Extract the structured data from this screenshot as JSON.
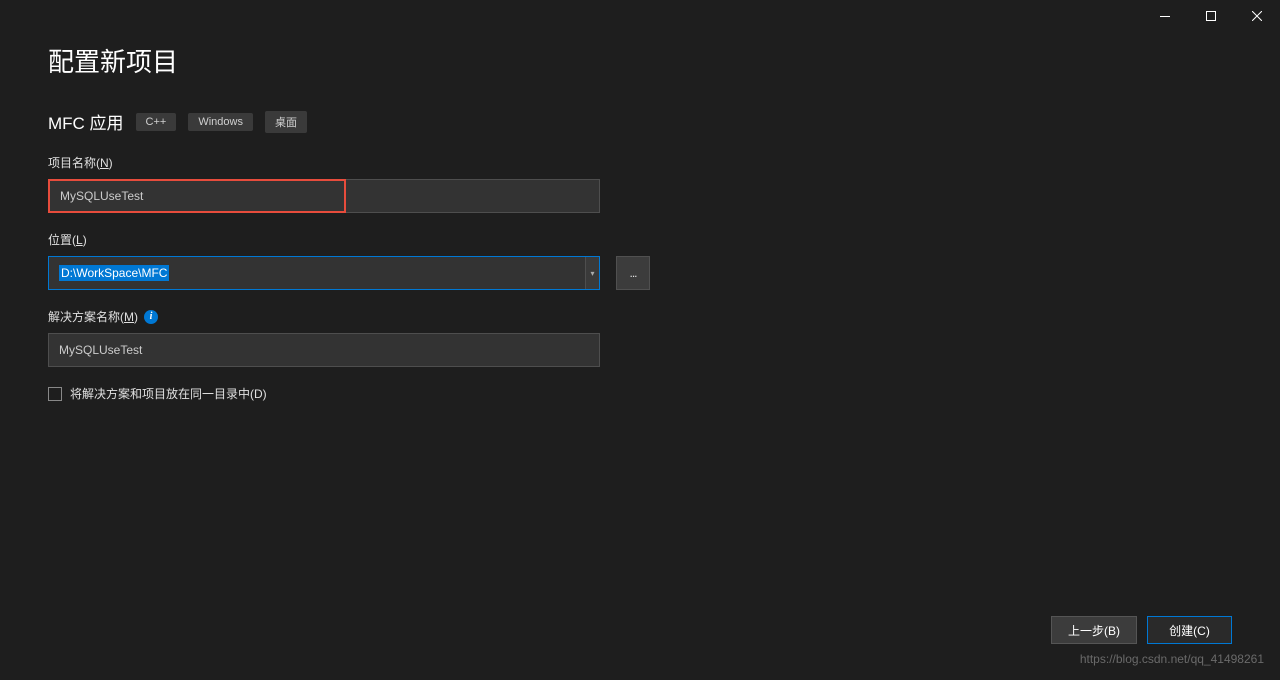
{
  "titlebar": {
    "minimize": "—",
    "maximize": "☐",
    "close": "✕"
  },
  "page": {
    "title": "配置新项目",
    "subtitle": "MFC 应用",
    "tags": [
      "C++",
      "Windows",
      "桌面"
    ]
  },
  "fields": {
    "project_name": {
      "label_prefix": "项目名称(",
      "label_key": "N",
      "label_suffix": ")",
      "value": "MySQLUseTest"
    },
    "location": {
      "label_prefix": "位置(",
      "label_key": "L",
      "label_suffix": ")",
      "value": "D:\\WorkSpace\\MFC",
      "browse": "..."
    },
    "solution_name": {
      "label_prefix": "解决方案名称(",
      "label_key": "M",
      "label_suffix": ")",
      "value": "MySQLUseTest",
      "info": "i"
    },
    "same_dir": {
      "label_prefix": "将解决方案和项目放在同一目录中(",
      "label_key": "D",
      "label_suffix": ")"
    }
  },
  "footer": {
    "back_prefix": "上一步(",
    "back_key": "B",
    "back_suffix": ")",
    "create_prefix": "创建(",
    "create_key": "C",
    "create_suffix": ")"
  },
  "watermark": "https://blog.csdn.net/qq_41498261"
}
